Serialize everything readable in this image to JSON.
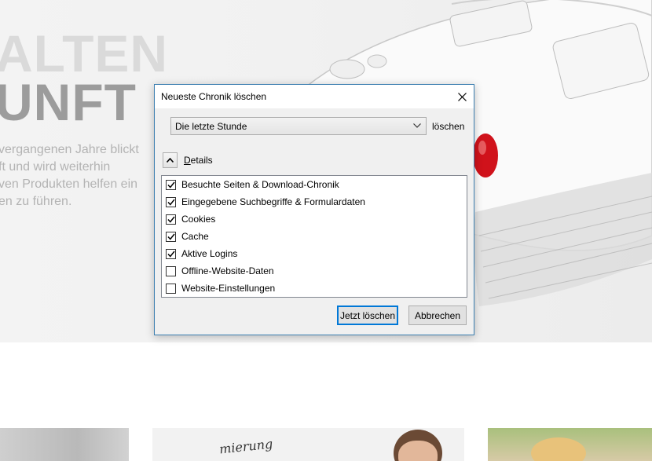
{
  "background": {
    "hero_line1": "ALTEN",
    "hero_line2": "UNFT",
    "paragraph_lines": [
      "vergangenen Jahre blickt",
      "ft und wird weiterhin",
      "ven Produkten helfen ein",
      "en zu führen."
    ],
    "thumbnail_text": "mierung"
  },
  "dialog": {
    "title": "Neueste Chronik löschen",
    "close_icon": "close-icon",
    "range": {
      "selected": "Die letzte Stunde",
      "label": "löschen"
    },
    "details": {
      "first_letter": "D",
      "rest": "etails",
      "expanded": true
    },
    "items": [
      {
        "label": "Besuchte Seiten & Download-Chronik",
        "checked": true
      },
      {
        "label": "Eingegebene Suchbegriffe & Formulardaten",
        "checked": true
      },
      {
        "label": "Cookies",
        "checked": true
      },
      {
        "label": "Cache",
        "checked": true
      },
      {
        "label": "Aktive Logins",
        "checked": true
      },
      {
        "label": "Offline-Website-Daten",
        "checked": false
      },
      {
        "label": "Website-Einstellungen",
        "checked": false
      }
    ],
    "buttons": {
      "confirm": "Jetzt löschen",
      "cancel": "Abbrechen"
    }
  },
  "colors": {
    "accent": "#0078d7",
    "dialog_border": "#3c7fb1",
    "cursor_red": "#d0121b"
  }
}
